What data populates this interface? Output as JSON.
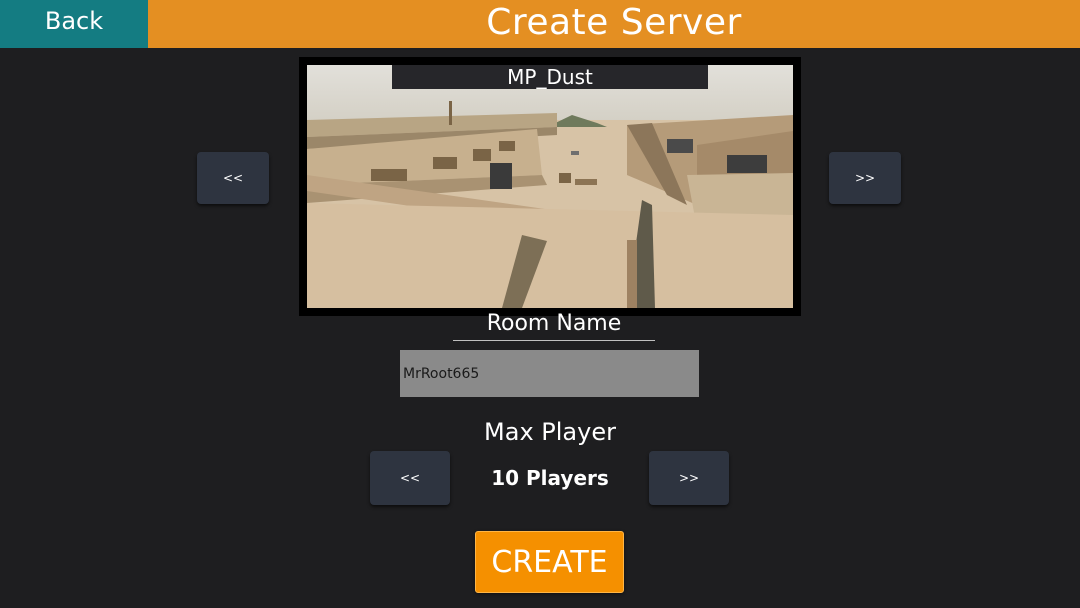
{
  "header": {
    "back_label": "Back",
    "title": "Create Server",
    "bar_color": "#e48f22",
    "back_color": "#147c82"
  },
  "map_selector": {
    "map_name": "MP_Dust",
    "prev_label": "<<",
    "next_label": ">>"
  },
  "room": {
    "label": "Room Name",
    "value": "MrRoot665"
  },
  "max_player": {
    "label": "Max Player",
    "value": "10 Players",
    "prev_label": "<<",
    "next_label": ">>"
  },
  "create_button": {
    "label": "CREATE",
    "color": "#f59000"
  }
}
